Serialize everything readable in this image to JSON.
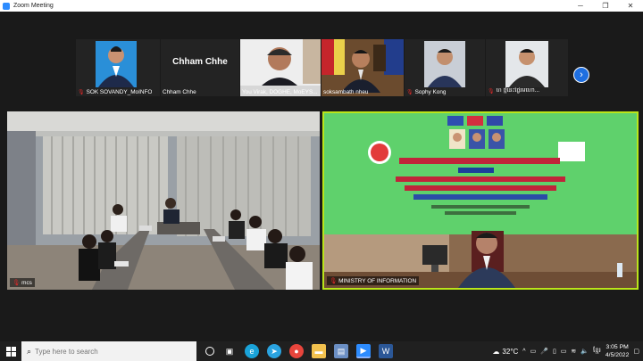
{
  "window": {
    "title": "Zoom Meeting"
  },
  "participants": [
    {
      "name": "SOK SOVANDY_MoINFO",
      "muted": true
    },
    {
      "name": "Chham Chhe",
      "big_name": "Chham Chhe",
      "muted": false
    },
    {
      "name": "You Virak, DOGHE, MoEYS...",
      "muted": false
    },
    {
      "name": "soksambath nheu",
      "muted": false
    },
    {
      "name": "Sophy Kong",
      "muted": true
    },
    {
      "name": "ហ ថ្មីនេះថ្ងៃរមហោ...",
      "muted": true
    }
  ],
  "main_videos": {
    "left": {
      "label": "mcs",
      "muted": true
    },
    "right": {
      "label": "MINISTRY OF INFORMATION",
      "muted": true
    }
  },
  "taskbar": {
    "search_placeholder": "Type here to search",
    "weather": "32°C",
    "language": "ខ្មែរ",
    "time": "3:05 PM",
    "date": "4/5/2022"
  },
  "colors": {
    "zoom_blue": "#2d8cff",
    "active_border": "#b9e51a",
    "banner_green": "#5fd16c"
  }
}
